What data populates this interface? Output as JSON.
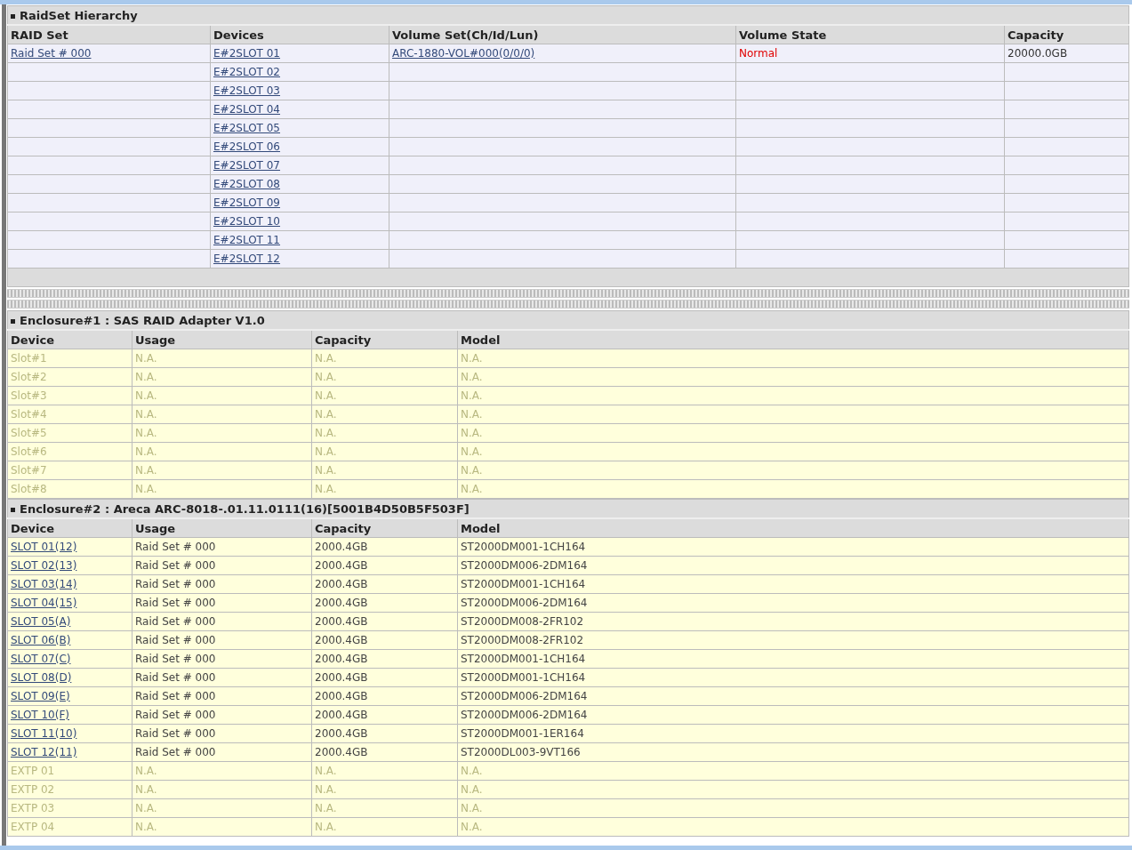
{
  "raidset": {
    "title": "RaidSet Hierarchy",
    "columns": [
      "RAID Set",
      "Devices",
      "Volume Set(Ch/Id/Lun)",
      "Volume State",
      "Capacity"
    ],
    "raid_set": "Raid Set # 000",
    "volume_set": "ARC-1880-VOL#000(0/0/0)",
    "volume_state": "Normal",
    "capacity": "20000.0GB",
    "devices": [
      "E#2SLOT 01",
      "E#2SLOT 02",
      "E#2SLOT 03",
      "E#2SLOT 04",
      "E#2SLOT 05",
      "E#2SLOT 06",
      "E#2SLOT 07",
      "E#2SLOT 08",
      "E#2SLOT 09",
      "E#2SLOT 10",
      "E#2SLOT 11",
      "E#2SLOT 12"
    ]
  },
  "enclosures": [
    {
      "title": "Enclosure#1 : SAS RAID Adapter V1.0",
      "columns": [
        "Device",
        "Usage",
        "Capacity",
        "Model"
      ],
      "rows": [
        {
          "kind": "empty",
          "device": "Slot#1",
          "usage": "N.A.",
          "capacity": "N.A.",
          "model": "N.A."
        },
        {
          "kind": "empty",
          "device": "Slot#2",
          "usage": "N.A.",
          "capacity": "N.A.",
          "model": "N.A."
        },
        {
          "kind": "empty",
          "device": "Slot#3",
          "usage": "N.A.",
          "capacity": "N.A.",
          "model": "N.A."
        },
        {
          "kind": "empty",
          "device": "Slot#4",
          "usage": "N.A.",
          "capacity": "N.A.",
          "model": "N.A."
        },
        {
          "kind": "empty",
          "device": "Slot#5",
          "usage": "N.A.",
          "capacity": "N.A.",
          "model": "N.A."
        },
        {
          "kind": "empty",
          "device": "Slot#6",
          "usage": "N.A.",
          "capacity": "N.A.",
          "model": "N.A."
        },
        {
          "kind": "empty",
          "device": "Slot#7",
          "usage": "N.A.",
          "capacity": "N.A.",
          "model": "N.A."
        },
        {
          "kind": "empty",
          "device": "Slot#8",
          "usage": "N.A.",
          "capacity": "N.A.",
          "model": "N.A."
        }
      ]
    },
    {
      "title": "Enclosure#2 : Areca ARC-8018-.01.11.0111(16)[5001B4D50B5F503F]",
      "columns": [
        "Device",
        "Usage",
        "Capacity",
        "Model"
      ],
      "rows": [
        {
          "kind": "drive",
          "device": "SLOT 01(12)",
          "usage": "Raid Set # 000",
          "capacity": "2000.4GB",
          "model": "ST2000DM001-1CH164"
        },
        {
          "kind": "drive",
          "device": "SLOT 02(13)",
          "usage": "Raid Set # 000",
          "capacity": "2000.4GB",
          "model": "ST2000DM006-2DM164"
        },
        {
          "kind": "drive",
          "device": "SLOT 03(14)",
          "usage": "Raid Set # 000",
          "capacity": "2000.4GB",
          "model": "ST2000DM001-1CH164"
        },
        {
          "kind": "drive",
          "device": "SLOT 04(15)",
          "usage": "Raid Set # 000",
          "capacity": "2000.4GB",
          "model": "ST2000DM006-2DM164"
        },
        {
          "kind": "drive",
          "device": "SLOT 05(A)",
          "usage": "Raid Set # 000",
          "capacity": "2000.4GB",
          "model": "ST2000DM008-2FR102"
        },
        {
          "kind": "drive",
          "device": "SLOT 06(B)",
          "usage": "Raid Set # 000",
          "capacity": "2000.4GB",
          "model": "ST2000DM008-2FR102"
        },
        {
          "kind": "drive",
          "device": "SLOT 07(C)",
          "usage": "Raid Set # 000",
          "capacity": "2000.4GB",
          "model": "ST2000DM001-1CH164"
        },
        {
          "kind": "drive",
          "device": "SLOT 08(D)",
          "usage": "Raid Set # 000",
          "capacity": "2000.4GB",
          "model": "ST2000DM001-1CH164"
        },
        {
          "kind": "drive",
          "device": "SLOT 09(E)",
          "usage": "Raid Set # 000",
          "capacity": "2000.4GB",
          "model": "ST2000DM006-2DM164"
        },
        {
          "kind": "drive",
          "device": "SLOT 10(F)",
          "usage": "Raid Set # 000",
          "capacity": "2000.4GB",
          "model": "ST2000DM006-2DM164"
        },
        {
          "kind": "drive",
          "device": "SLOT 11(10)",
          "usage": "Raid Set # 000",
          "capacity": "2000.4GB",
          "model": "ST2000DM001-1ER164"
        },
        {
          "kind": "drive",
          "device": "SLOT 12(11)",
          "usage": "Raid Set # 000",
          "capacity": "2000.4GB",
          "model": "ST2000DL003-9VT166"
        },
        {
          "kind": "empty",
          "device": "EXTP 01",
          "usage": "N.A.",
          "capacity": "N.A.",
          "model": "N.A."
        },
        {
          "kind": "empty",
          "device": "EXTP 02",
          "usage": "N.A.",
          "capacity": "N.A.",
          "model": "N.A."
        },
        {
          "kind": "empty",
          "device": "EXTP 03",
          "usage": "N.A.",
          "capacity": "N.A.",
          "model": "N.A."
        },
        {
          "kind": "empty",
          "device": "EXTP 04",
          "usage": "N.A.",
          "capacity": "N.A.",
          "model": "N.A."
        }
      ]
    }
  ]
}
